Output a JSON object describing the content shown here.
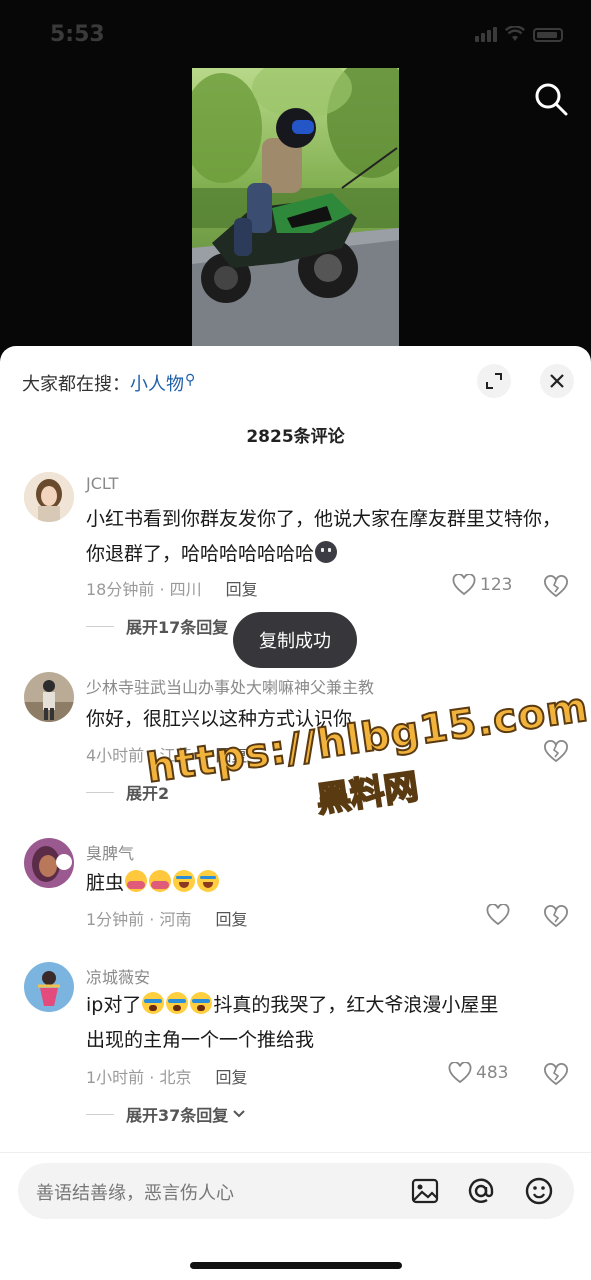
{
  "status_bar": {
    "time": "5:53"
  },
  "video": {
    "search_icon": "search-icon"
  },
  "sheet": {
    "hot_search_label": "大家都在搜：",
    "hot_search_keyword": "小人物",
    "comment_count": "2825条评论"
  },
  "comments": [
    {
      "user": "JCLT",
      "text": "小红书看到你群友发你了，他说大家在摩友群里艾特你，你退群了，哈哈哈哈哈哈哈",
      "time_location": "18分钟前 · 四川",
      "reply": "回复",
      "likes": "123",
      "expand": "展开17条回复"
    },
    {
      "user": "少林寺驻武当山办事处大喇嘛神父兼主教",
      "text": "你好，很肛兴以这种方式认识你",
      "time_location": "4小时前 · 江苏",
      "reply": "回复",
      "expand": "展开2"
    },
    {
      "user": "臭脾气",
      "text": "脏虫",
      "time_location": "1分钟前 · 河南",
      "reply": "回复"
    },
    {
      "user": "凉城薇安",
      "text_a": "ip对了",
      "text_b": "抖真的我哭了，红大爷浪漫小屋里",
      "text_c": "出现的主角一个一个推给我",
      "time_location": "1小时前 · 北京",
      "reply": "回复",
      "likes": "483",
      "expand": "展开37条回复"
    }
  ],
  "toast": "复制成功",
  "watermark": {
    "url": "https://hlbg15.com",
    "name": "黑料网"
  },
  "input": {
    "placeholder": "善语结善缘，恶言伤人心"
  }
}
